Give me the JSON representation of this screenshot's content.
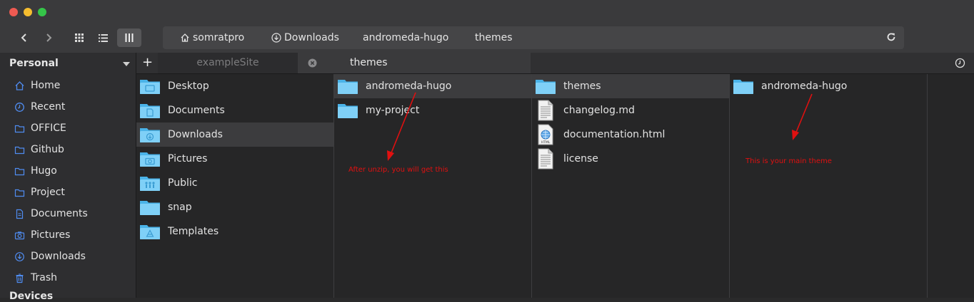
{
  "window": {
    "traffic_lights": [
      "#ee5a52",
      "#f5bd2f",
      "#35c549"
    ]
  },
  "toolbar": {
    "back_icon": "chevron-left-icon",
    "forward_icon": "chevron-right-icon",
    "view_modes": [
      "grid-view-icon",
      "list-view-icon",
      "column-view-icon"
    ],
    "selected_view": "column-view-icon",
    "breadcrumbs": [
      {
        "label": "somratpro",
        "icon": "home-icon"
      },
      {
        "label": "Downloads",
        "icon": "download-icon"
      },
      {
        "label": "andromeda-hugo",
        "icon": ""
      },
      {
        "label": "themes",
        "icon": ""
      }
    ],
    "reload_icon": "reload-icon"
  },
  "sidebar": {
    "section": "Personal",
    "items": [
      {
        "label": "Home",
        "icon": "home-icon"
      },
      {
        "label": "Recent",
        "icon": "clock-icon"
      },
      {
        "label": "OFFICE",
        "icon": "folder-icon"
      },
      {
        "label": "Github",
        "icon": "folder-icon"
      },
      {
        "label": "Hugo",
        "icon": "folder-icon"
      },
      {
        "label": "Project",
        "icon": "folder-icon"
      },
      {
        "label": "Documents",
        "icon": "document-icon"
      },
      {
        "label": "Pictures",
        "icon": "camera-icon"
      },
      {
        "label": "Downloads",
        "icon": "download-icon"
      },
      {
        "label": "Trash",
        "icon": "trash-icon"
      }
    ],
    "next_section": "Devices",
    "accent": "#4f8cf0"
  },
  "tabs": {
    "add_label": "+",
    "items": [
      {
        "label": "exampleSite",
        "active": false
      },
      {
        "label": "themes",
        "active": true
      }
    ],
    "history_icon": "history-icon"
  },
  "columns": [
    {
      "items": [
        {
          "label": "Desktop",
          "type": "folder",
          "emblem": "desktop",
          "selected": false
        },
        {
          "label": "Documents",
          "type": "folder",
          "emblem": "document",
          "selected": false
        },
        {
          "label": "Downloads",
          "type": "folder",
          "emblem": "download",
          "selected": true
        },
        {
          "label": "Pictures",
          "type": "folder",
          "emblem": "camera",
          "selected": false
        },
        {
          "label": "Public",
          "type": "folder",
          "emblem": "people",
          "selected": false
        },
        {
          "label": "snap",
          "type": "folder",
          "emblem": "",
          "selected": false
        },
        {
          "label": "Templates",
          "type": "folder",
          "emblem": "template",
          "selected": false
        }
      ]
    },
    {
      "items": [
        {
          "label": "andromeda-hugo",
          "type": "folder",
          "emblem": "",
          "selected": true
        },
        {
          "label": "my-project",
          "type": "folder",
          "emblem": "",
          "selected": false
        }
      ]
    },
    {
      "items": [
        {
          "label": "themes",
          "type": "folder",
          "emblem": "",
          "selected": true
        },
        {
          "label": "changelog.md",
          "type": "text",
          "emblem": "",
          "selected": false
        },
        {
          "label": "documentation.html",
          "type": "html",
          "emblem": "",
          "selected": false
        },
        {
          "label": "license",
          "type": "text",
          "emblem": "",
          "selected": false
        }
      ]
    },
    {
      "items": [
        {
          "label": "andromeda-hugo",
          "type": "folder",
          "emblem": "",
          "selected": false
        }
      ]
    },
    {
      "items": []
    }
  ],
  "annotations": [
    {
      "text": "After unzip, you will get this"
    },
    {
      "text": "This is your main theme"
    }
  ],
  "annotation_color": "#e01010"
}
